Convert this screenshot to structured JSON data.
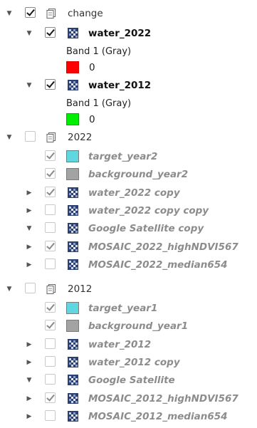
{
  "layers_panel": {
    "change": {
      "label": "change",
      "checked": true,
      "water_2022": {
        "label": "water_2022",
        "checked": true,
        "band": "Band 1 (Gray)",
        "legend_value": "0",
        "legend_color": "#ff0000"
      },
      "water_2012": {
        "label": "water_2012",
        "checked": true,
        "band": "Band 1 (Gray)",
        "legend_value": "0",
        "legend_color": "#00ee00"
      }
    },
    "group_2022": {
      "label": "2022",
      "checked": false,
      "items": [
        {
          "label": "target_year2",
          "checked": true,
          "icon": "cyan-swatch-icon",
          "color": "#5fd6e0"
        },
        {
          "label": "background_year2",
          "checked": true,
          "icon": "gray-swatch-icon",
          "color": "#a3a3a3"
        },
        {
          "label": "water_2022 copy",
          "checked": true,
          "icon": "raster-layer-icon"
        },
        {
          "label": "water_2022 copy copy",
          "checked": false,
          "icon": "raster-layer-icon"
        },
        {
          "label": "Google Satellite copy",
          "checked": false,
          "icon": "raster-layer-icon"
        },
        {
          "label": "MOSAIC_2022_highNDVI567",
          "checked": true,
          "icon": "raster-layer-icon"
        },
        {
          "label": "MOSAIC_2022_median654",
          "checked": false,
          "icon": "raster-layer-icon"
        }
      ]
    },
    "group_2012": {
      "label": "2012",
      "checked": false,
      "items": [
        {
          "label": "target_year1",
          "checked": true,
          "icon": "cyan-swatch-icon",
          "color": "#5fd6e0"
        },
        {
          "label": "background_year1",
          "checked": true,
          "icon": "gray-swatch-icon",
          "color": "#a3a3a3"
        },
        {
          "label": "water_2012",
          "checked": false,
          "icon": "raster-layer-icon"
        },
        {
          "label": "water_2012 copy",
          "checked": false,
          "icon": "raster-layer-icon"
        },
        {
          "label": "Google Satellite",
          "checked": false,
          "icon": "raster-layer-icon"
        },
        {
          "label": "MOSAIC_2012_highNDVI567",
          "checked": true,
          "icon": "raster-layer-icon"
        },
        {
          "label": "MOSAIC_2012_median654",
          "checked": false,
          "icon": "raster-layer-icon"
        }
      ]
    }
  }
}
